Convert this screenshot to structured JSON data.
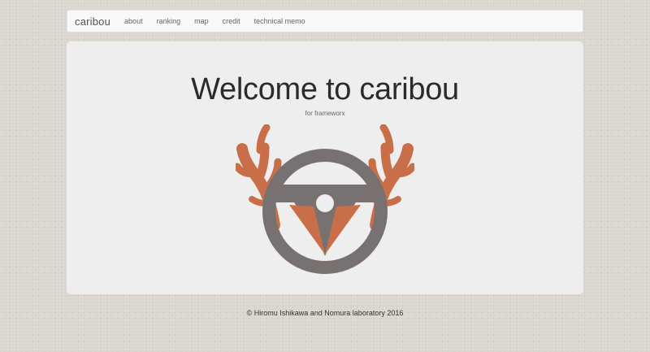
{
  "navbar": {
    "brand": "caribou",
    "items": [
      {
        "label": "about"
      },
      {
        "label": "ranking"
      },
      {
        "label": "map"
      },
      {
        "label": "credit"
      },
      {
        "label": "technical memo"
      }
    ]
  },
  "hero": {
    "title": "Welcome to caribou",
    "subtitle": "for frameworx",
    "logo": {
      "icon": "caribou-steering-wheel-logo",
      "wheel_color": "#787171",
      "antler_color": "#c86f49"
    }
  },
  "footer": {
    "text": "© Hiromu Ishikawa and Nomura laboratory 2016"
  },
  "colors": {
    "background": "#dad6cf",
    "panel": "#eeeeee",
    "navbar": "#f8f8f8"
  }
}
